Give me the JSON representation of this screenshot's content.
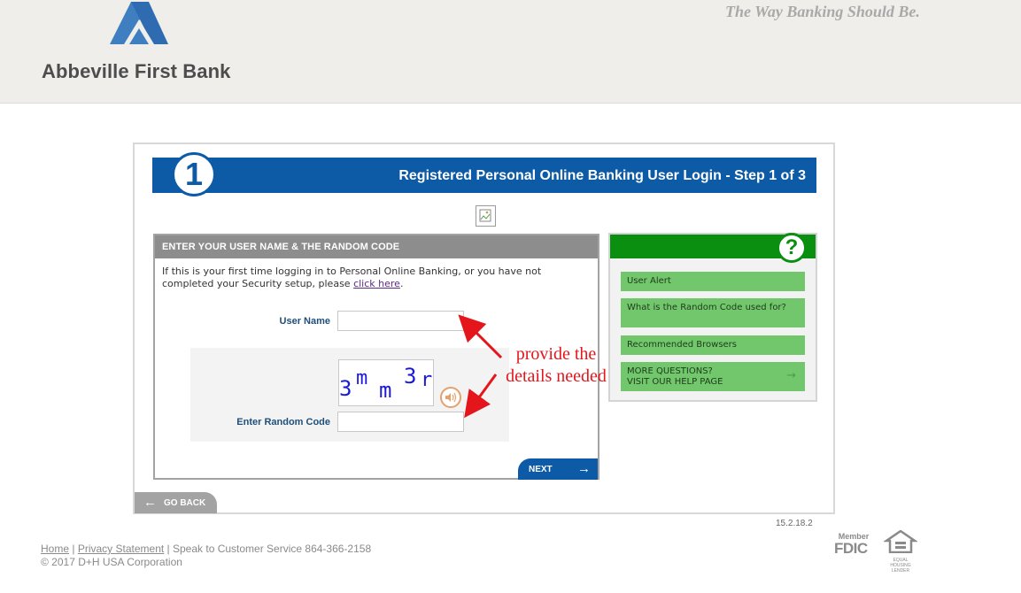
{
  "header": {
    "bank_name": "Abbeville First Bank",
    "tagline": "The Way Banking Should Be."
  },
  "step": {
    "number": "1",
    "title": "Registered Personal Online Banking User Login - Step 1 of 3"
  },
  "login": {
    "heading": "ENTER YOUR USER NAME & THE RANDOM CODE",
    "intro_text": "If this is your first time logging in to Personal Online Banking, or you have not completed your Security setup, please",
    "click_here": "click here",
    "intro_end": ".",
    "username_label": "User Name",
    "username_value": "",
    "random_code_label": "Enter Random Code",
    "random_code_value": "",
    "captcha_chars": [
      "3",
      "m",
      "m",
      "3",
      "r"
    ],
    "next_label": "NEXT"
  },
  "help": {
    "items": [
      {
        "label": "User Alert"
      },
      {
        "label": "What is the Random Code used for?"
      },
      {
        "label": "Recommended Browsers"
      },
      {
        "label_line1": "MORE QUESTIONS?",
        "label_line2": "VISIT OUR HELP PAGE"
      }
    ]
  },
  "go_back_label": "GO BACK",
  "version": "15.2.18.2",
  "annotation": {
    "line1": "provide the",
    "line2": "details needed"
  },
  "footer": {
    "home": "Home",
    "sep1": "|",
    "privacy": "Privacy Statement",
    "service": "| Speak to Customer Service 864-366-2158",
    "copyright": "© 2017 D+H USA Corporation"
  },
  "badges": {
    "fdic_member": "Member",
    "fdic": "FDIC",
    "ehl": "EQUAL HOUSING LENDER"
  },
  "colors": {
    "brand_blue": "#0d5aa7",
    "help_green": "#0b8f10",
    "annotation_red": "#e4161c"
  }
}
